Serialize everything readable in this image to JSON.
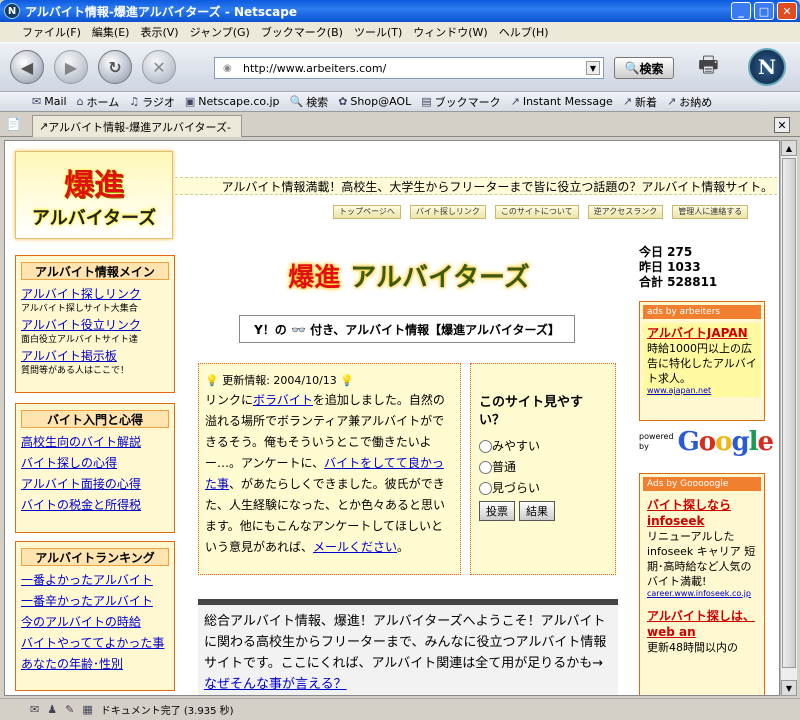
{
  "window": {
    "title": "アルバイト情報-爆進アルバイターズ - Netscape"
  },
  "menu": [
    "ファイル(F)",
    "編集(E)",
    "表示(V)",
    "ジャンプ(G)",
    "ブックマーク(B)",
    "ツール(T)",
    "ウィンドウ(W)",
    "ヘルプ(H)"
  ],
  "toolbar": {
    "url": "http://www.arbeiters.com/",
    "search_label": "検索"
  },
  "bookmarks": [
    "Mail",
    "ホーム",
    "ラジオ",
    "Netscape.co.jp",
    "検索",
    "Shop@AOL",
    "ブックマーク",
    "Instant Message",
    "新着",
    "お納め"
  ],
  "tab": {
    "label": "アルバイト情報-爆進アルバイターズ-"
  },
  "status": {
    "text": "ドキュメント完了 (3.935 秒)"
  },
  "page": {
    "logo_line1": "爆進",
    "logo_line2": "アルバイターズ",
    "tagline": "アルバイト情報満載！高校生、大学生からフリーターまで皆に役立つ話題の？アルバイト情報サイト。",
    "topnav": [
      "トップページへ",
      "バイト探しリンク",
      "このサイトについて",
      "逆アクセスランク",
      "管理人に連絡する"
    ],
    "side1": {
      "title": "アルバイト情報メイン",
      "items": [
        {
          "link": "アルバイト探しリンク",
          "sub": "アルバイト探しサイト大集合"
        },
        {
          "link": "アルバイト役立リンク",
          "sub": "面白役立アルバイトサイト達"
        },
        {
          "link": "アルバイト掲示板",
          "sub": "質問等がある人はここで！"
        }
      ]
    },
    "side2": {
      "title": "バイト入門と心得",
      "items": [
        "高校生向のバイト解説",
        "バイト探しの心得",
        "アルバイト面接の心得",
        "バイトの税金と所得税"
      ]
    },
    "side3": {
      "title": "アルバイトランキング",
      "items": [
        "一番よかったアルバイト",
        "一番辛かったアルバイト",
        "今のアルバイトの時給",
        "バイトやっててよかった事",
        "あなたの年齢･性別"
      ]
    },
    "biglogo_red": "爆進",
    "biglogo_green": "アルバイターズ",
    "ybox": "Y！の 👓 付き、アルバイト情報【爆進アルバイターズ】",
    "counter": {
      "today": "今日 275",
      "yesterday": "昨日 1033",
      "total": "合計 528811"
    },
    "info": {
      "header": "更新情報: 2004/10/13",
      "t1": "リンクに",
      "l1": "ボラバイト",
      "t2": "を追加しました。自然の溢れる場所でボランティア兼アルバイトができるそう。俺もそういうとこで働きたいよー…。アンケートに、",
      "l2": "バイトをしてて良かった事",
      "t3": "、があたらしくできました。彼氏ができた、人生経験になった、とか色々あると思います。他にもこんなアンケートしてほしいという意見があれば、",
      "l3": "メールください",
      "t4": "。"
    },
    "poll": {
      "question": "このサイト見やすい？",
      "options": [
        "みやすい",
        "普通",
        "見づらい"
      ],
      "vote": "投票",
      "result": "結果"
    },
    "welcome": {
      "text": "総合アルバイト情報、爆進！アルバイターズへようこそ！アルバイトに関わる高校生からフリーターまで、みんなに役立つアルバイト情報サイトです。ここにくれば、アルバイト関連は全て用が足りるかも→",
      "link": "なぜそんな事が言える？"
    },
    "ad1": {
      "head": "ads by arbeiters",
      "link": "アルバイトJAPAN",
      "text": "時給1000円以上の広告に特化したアルバイト求人。",
      "url": "www.ajapan.net"
    },
    "google": {
      "powered": "powered by",
      "logo": "Google"
    },
    "ad2": {
      "head": "Ads by Gooooogle",
      "link1": "バイト探しなら infoseek",
      "text1": "リニューアルした infoseek キャリア 短期･高時給など人気のバイト満載!",
      "url1": "career.www.infoseek.co.jp",
      "link2": "アルバイト探しは、web an",
      "text2": "更新48時間以内の"
    }
  },
  "colors": {
    "accent": "#e06a10",
    "link": "#0000cc",
    "titlebar": "#0b5ae0"
  }
}
